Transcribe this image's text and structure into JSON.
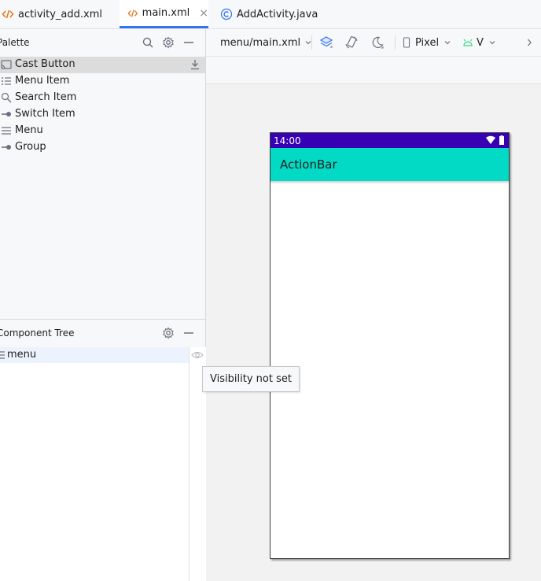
{
  "tabs": [
    {
      "label": "activity_add.xml",
      "icon": "xml-icon",
      "active": false
    },
    {
      "label": "main.xml",
      "icon": "xml-icon",
      "active": true,
      "close": "×"
    },
    {
      "label": "AddActivity.java",
      "icon": "java-class-icon",
      "active": false
    }
  ],
  "palette": {
    "title": "Palette",
    "items": [
      {
        "label": "Cast Button",
        "icon": "cast-icon",
        "selected": true
      },
      {
        "label": "Menu Item",
        "icon": "menu-item-icon"
      },
      {
        "label": "Search Item",
        "icon": "search-item-icon"
      },
      {
        "label": "Switch Item",
        "icon": "switch-item-icon"
      },
      {
        "label": "Menu",
        "icon": "menu-icon"
      },
      {
        "label": "Group",
        "icon": "group-icon"
      }
    ]
  },
  "component_tree": {
    "title": "Component Tree",
    "root": {
      "label": "menu",
      "icon": "menu-icon"
    }
  },
  "toolbar": {
    "file_label": "menu/main.xml",
    "device_label": "Pixel",
    "api_label": "V"
  },
  "device": {
    "status_time": "14:00",
    "actionbar_title": "ActionBar"
  },
  "tooltip": {
    "text": "Visibility not set"
  },
  "colors": {
    "accent": "#3574f0",
    "status_bar": "#3700b3",
    "action_bar": "#03dac5",
    "xml_icon": "#e8731d",
    "android_green": "#3ddc84"
  }
}
